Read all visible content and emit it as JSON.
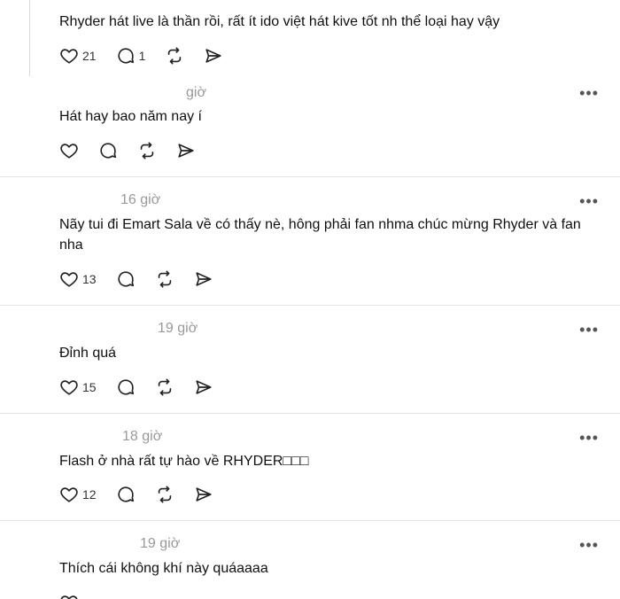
{
  "posts": [
    {
      "time": "",
      "text": "Rhyder hát live là thần rồi, rất ít ido việt hát kive tốt nh thể loại hay vậy",
      "likes": "21",
      "replies": "1"
    },
    {
      "time": "giờ",
      "text": "Hát hay bao năm nay í",
      "likes": "",
      "replies": ""
    },
    {
      "time": "16 giờ",
      "text": "Nãy tui đi Emart Sala về có thấy nè, hông phải fan nhma chúc mừng Rhyder và fan nha",
      "likes": "13",
      "replies": ""
    },
    {
      "time": "19 giờ",
      "text": "Đỉnh quá",
      "likes": "15",
      "replies": ""
    },
    {
      "time": "18 giờ",
      "text": "Flash ở nhà rất tự hào về RHYDER□□□",
      "likes": "12",
      "replies": ""
    },
    {
      "time": "19 giờ",
      "text": "Thích cái không khí này quáaaaa",
      "likes": "",
      "replies": ""
    }
  ],
  "more_label": "•••",
  "icons": [
    "heart-icon",
    "comment-icon",
    "repost-icon",
    "share-icon"
  ]
}
